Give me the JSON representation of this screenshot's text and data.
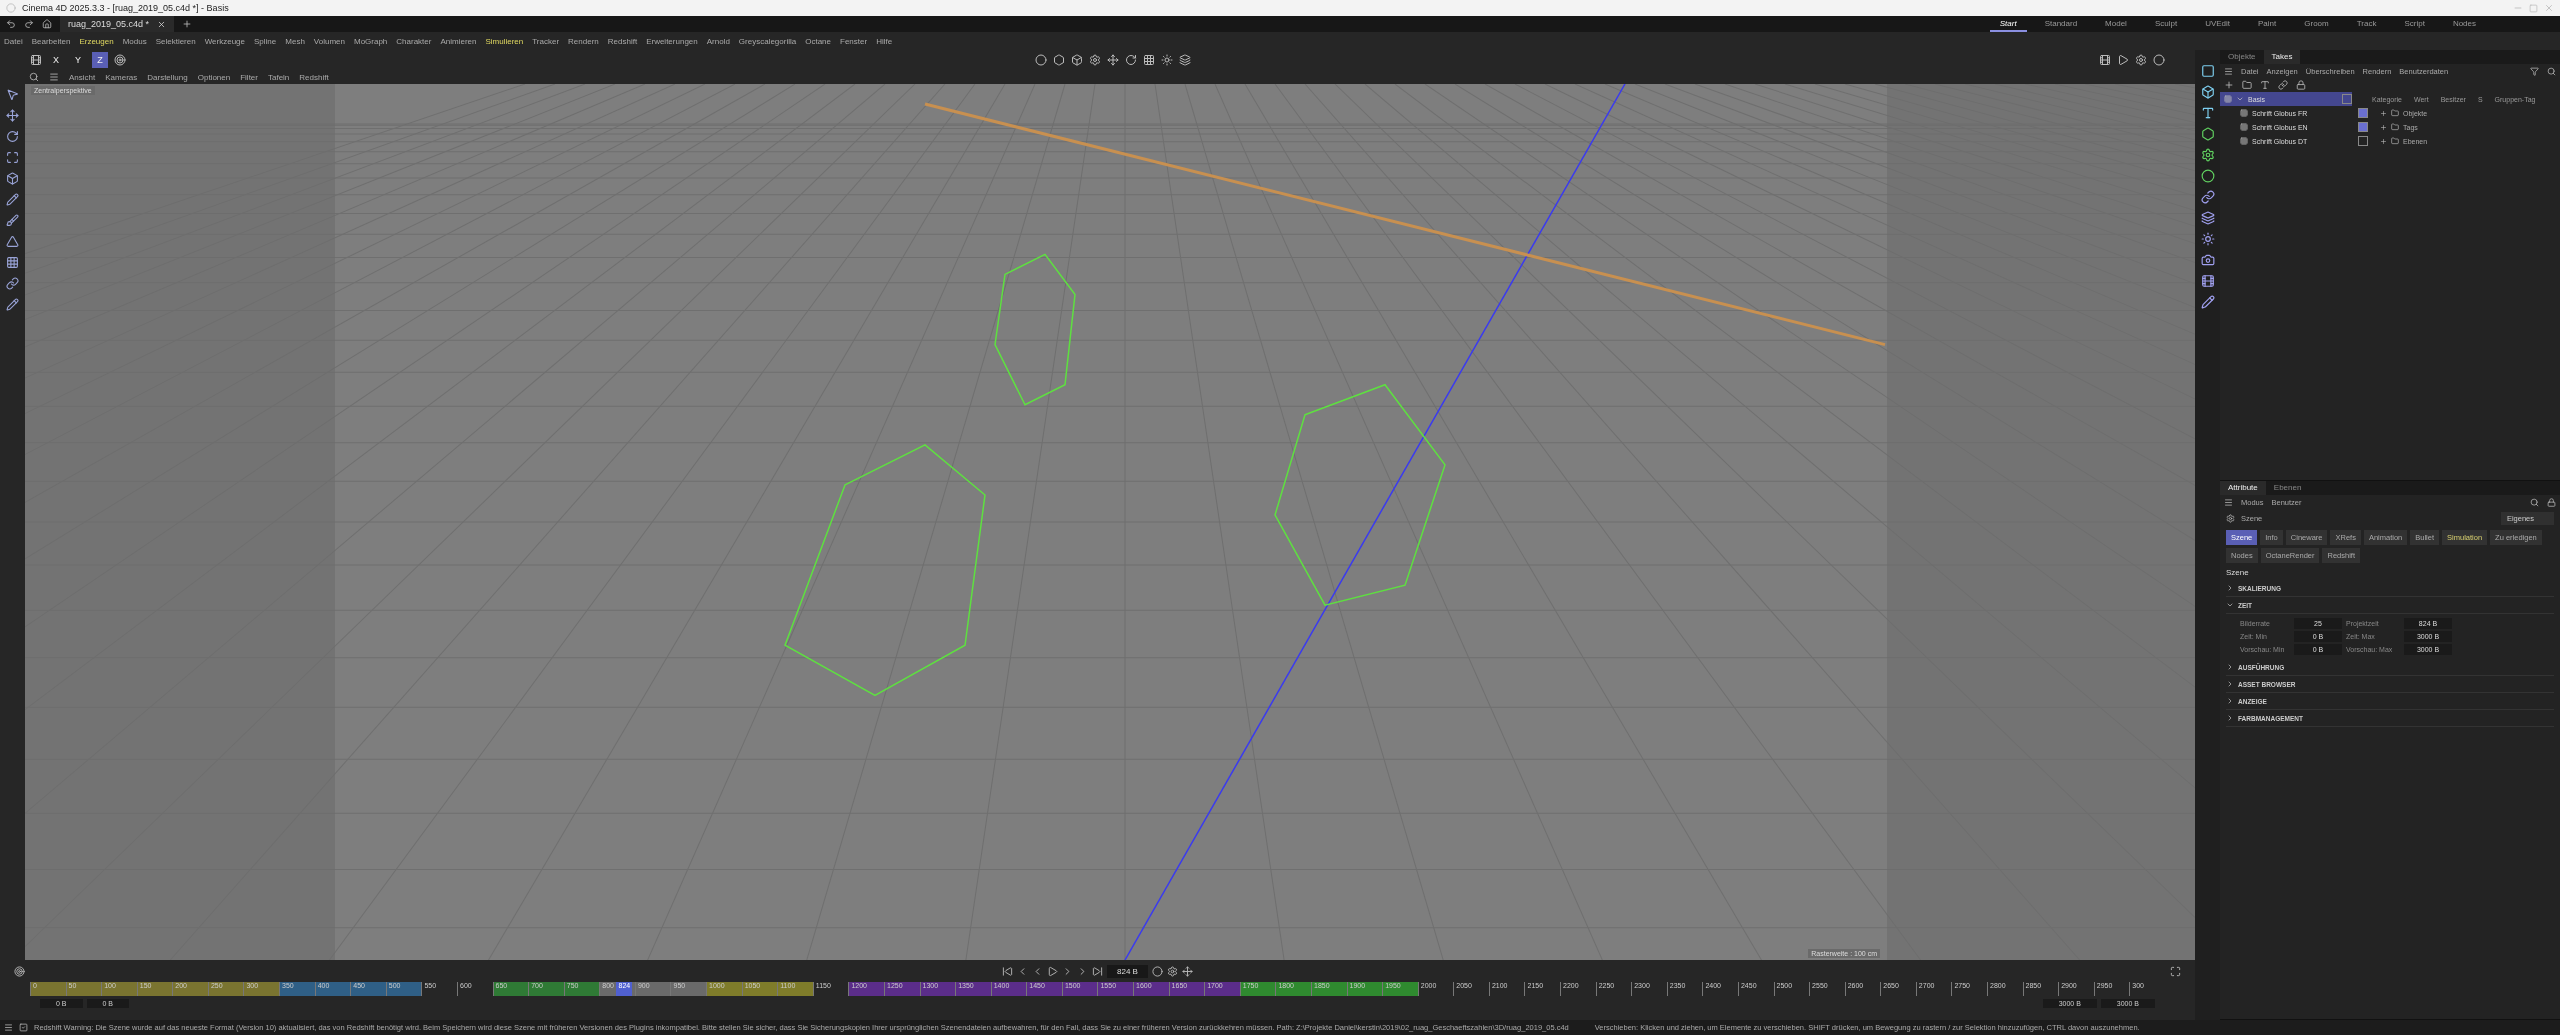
{
  "window": {
    "title": "Cinema 4D 2025.3.3 - [ruag_2019_05.c4d *] - Basis"
  },
  "document_tab": {
    "label": "ruag_2019_05.c4d *"
  },
  "menu": [
    {
      "label": "Datei",
      "highlighted": false
    },
    {
      "label": "Bearbeiten",
      "highlighted": false
    },
    {
      "label": "Erzeugen",
      "highlighted": true
    },
    {
      "label": "Modus",
      "highlighted": false
    },
    {
      "label": "Selektieren",
      "highlighted": false
    },
    {
      "label": "Werkzeuge",
      "highlighted": false
    },
    {
      "label": "Spline",
      "highlighted": false
    },
    {
      "label": "Mesh",
      "highlighted": false
    },
    {
      "label": "Volumen",
      "highlighted": false
    },
    {
      "label": "MoGraph",
      "highlighted": false
    },
    {
      "label": "Charakter",
      "highlighted": false
    },
    {
      "label": "Animieren",
      "highlighted": false
    },
    {
      "label": "Simulieren",
      "highlighted": true
    },
    {
      "label": "Tracker",
      "highlighted": false
    },
    {
      "label": "Rendern",
      "highlighted": false
    },
    {
      "label": "Redshift",
      "highlighted": false
    },
    {
      "label": "Erweiterungen",
      "highlighted": false
    },
    {
      "label": "Arnold",
      "highlighted": false
    },
    {
      "label": "Greyscalegorilla",
      "highlighted": false
    },
    {
      "label": "Octane",
      "highlighted": false
    },
    {
      "label": "Fenster",
      "highlighted": false
    },
    {
      "label": "Hilfe",
      "highlighted": false
    }
  ],
  "layouts": [
    {
      "label": "Start",
      "selected": true
    },
    {
      "label": "Standard",
      "selected": false
    },
    {
      "label": "Model",
      "selected": false
    },
    {
      "label": "Sculpt",
      "selected": false
    },
    {
      "label": "UVEdit",
      "selected": false
    },
    {
      "label": "Paint",
      "selected": false
    },
    {
      "label": "Groom",
      "selected": false
    },
    {
      "label": "Track",
      "selected": false
    },
    {
      "label": "Script",
      "selected": false
    },
    {
      "label": "Nodes",
      "selected": false
    }
  ],
  "axes": [
    {
      "label": "X",
      "selected": false
    },
    {
      "label": "Y",
      "selected": false
    },
    {
      "label": "Z",
      "selected": true
    }
  ],
  "viewport": {
    "menu": [
      "Ansicht",
      "Kameras",
      "Darstellung",
      "Optionen",
      "Filter",
      "Tafeln",
      "Redshift"
    ],
    "camera_label": "Zentralperspektive",
    "grid_label": "Rasterweite : 100 cm"
  },
  "timeline": {
    "frame": "824 B",
    "playhead": {
      "label": "824",
      "level": 0.2747
    },
    "ruler": [
      {
        "color": "#7a7430",
        "ticks": [
          "0",
          "50",
          "100",
          "150",
          "200",
          "250",
          "300"
        ]
      },
      {
        "color": "#2f5f86",
        "ticks": [
          "350",
          "400",
          "450",
          "500"
        ]
      },
      {
        "ticks": [
          "550",
          "600"
        ]
      },
      {
        "color": "#2f7a35",
        "ticks": [
          "650",
          "700",
          "750"
        ]
      },
      {
        "color": "#6a6a6a",
        "ticks": [
          "800",
          "900",
          "950"
        ]
      },
      {
        "color": "#7f7c2a",
        "ticks": [
          "1000",
          "1050",
          "1100"
        ]
      },
      {
        "ticks": [
          "1150"
        ]
      },
      {
        "color": "#5b2d8a",
        "ticks": [
          "1200",
          "1250",
          "1300",
          "1350",
          "1400",
          "1450",
          "1500",
          "1550",
          "1600",
          "1650",
          "1700"
        ]
      },
      {
        "color": "#2f8a2f",
        "ticks": [
          "1750",
          "1800",
          "1850",
          "1900",
          "1950"
        ]
      },
      {
        "ticks": [
          "2000",
          "2050",
          "2100",
          "2150",
          "2200",
          "2250",
          "2300",
          "2350",
          "2400",
          "2450",
          "2500",
          "2550",
          "2600",
          "2650",
          "2700",
          "2750",
          "2800",
          "2850",
          "2900",
          "2950",
          "300"
        ]
      }
    ],
    "start_fields": [
      "0 B",
      "0 B"
    ],
    "end_fields": [
      "3000 B",
      "3000 B"
    ]
  },
  "takes_panel": {
    "tabs": [
      {
        "label": "Objekte",
        "selected": false
      },
      {
        "label": "Takes",
        "selected": true
      }
    ],
    "menu": [
      "Datei",
      "Anzeigen",
      "Überschreiben",
      "Rendern",
      "Benutzerdaten"
    ],
    "takes": [
      {
        "label": "Basis",
        "checked": false,
        "selected": true,
        "expanded": true,
        "children": [
          {
            "label": "Schrift Globus FR",
            "checked": true,
            "selected": false
          },
          {
            "label": "Schrift Globus EN",
            "checked": true,
            "selected": false
          },
          {
            "label": "Schrift Globus DT",
            "checked": false,
            "selected": false
          }
        ]
      }
    ],
    "columns": [
      "Kategorie",
      "Wert",
      "Besitzer",
      "S",
      "Gruppen-Tag"
    ],
    "categories": [
      "Objekte",
      "Tags",
      "Ebenen"
    ]
  },
  "attributes_panel": {
    "tabs": [
      {
        "label": "Attribute",
        "selected": true
      },
      {
        "label": "Ebenen",
        "selected": false
      }
    ],
    "menu": [
      "Modus",
      "Benutzer"
    ],
    "object": "Szene",
    "preset": "Eigenes",
    "pages": [
      {
        "label": "Szene",
        "selected": true,
        "highlighted": false
      },
      {
        "label": "Info",
        "selected": false,
        "highlighted": false
      },
      {
        "label": "Cineware",
        "selected": false,
        "highlighted": false
      },
      {
        "label": "XRefs",
        "selected": false,
        "highlighted": false
      },
      {
        "label": "Animation",
        "selected": false,
        "highlighted": false
      },
      {
        "label": "Bullet",
        "selected": false,
        "highlighted": false
      },
      {
        "label": "Simulation",
        "selected": false,
        "highlighted": true
      },
      {
        "label": "Zu erledigen",
        "selected": false,
        "highlighted": false
      },
      {
        "label": "Nodes",
        "selected": false,
        "highlighted": false
      },
      {
        "label": "OctaneRender",
        "selected": false,
        "highlighted": false
      },
      {
        "label": "Redshift",
        "selected": false,
        "highlighted": false
      }
    ],
    "section": "Szene",
    "groups": [
      {
        "label": "SKALIERUNG",
        "expanded": false
      },
      {
        "label": "ZEIT",
        "expanded": true,
        "fields": [
          {
            "label": "Bilderrate",
            "value": "25"
          },
          {
            "label": "Projektzeit",
            "value": "824 B"
          },
          {
            "label": "Zeit: Min",
            "value": "0 B"
          },
          {
            "label": "Zeit: Max",
            "value": "3000 B"
          },
          {
            "label": "Vorschau: Min",
            "value": "0 B"
          },
          {
            "label": "Vorschau: Max",
            "value": "3000 B"
          }
        ]
      },
      {
        "label": "AUSFÜHRUNG",
        "expanded": false
      },
      {
        "label": "ASSET BROWSER",
        "expanded": false
      },
      {
        "label": "ANZEIGE",
        "expanded": false
      },
      {
        "label": "FARBMANAGEMENT",
        "expanded": false
      }
    ]
  },
  "status_bar": {
    "message": "Redshift Warning: Die Szene wurde auf das neueste Format (Version 10) aktualisiert, das von Redshift benötigt wird. Beim Speichern wird diese Szene mit früheren Versionen des Plugins inkompatibel. Bitte stellen Sie sicher, dass Sie Sicherungskopien Ihrer ursprünglichen Szenendateien aufbewahren, für den Fall, dass Sie zu einer früheren Version zurückkehren müssen. Path: Z:\\Projekte Daniel\\kerstin\\2019\\02_ruag_Geschaeftszahlen\\3D/ruag_2019_05.c4d",
    "hint": "Verschieben: Klicken und ziehen, um Elemente zu verschieben. SHIFT drücken, um Bewegung zu rastern / zur Selektion hinzuzufügen, CTRL davon auszunehmen."
  }
}
